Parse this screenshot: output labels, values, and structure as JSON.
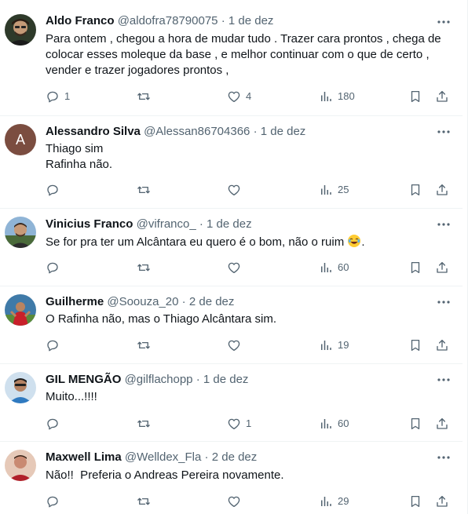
{
  "colors": {
    "text": "#0f1419",
    "secondary": "#536471",
    "border": "#eff3f4"
  },
  "icons": {
    "reply": "reply-icon",
    "retweet": "retweet-icon",
    "like": "like-icon",
    "views": "views-icon",
    "bookmark": "bookmark-icon",
    "share": "share-icon",
    "more": "more-icon"
  },
  "tweets": [
    {
      "name": "Aldo Franco",
      "handle": "@aldofra78790075",
      "dot": "·",
      "date": "1 de dez",
      "lines": [
        "Para ontem , chegou a hora de mudar tudo . Trazer cara prontos , chega de",
        "colocar esses moleque da base , e melhor continuar com o que de certo ,",
        "vender e trazer jogadores prontos ,"
      ],
      "replies": "1",
      "retweets": "",
      "likes": "4",
      "views": "180"
    },
    {
      "name": "Alessandro Silva",
      "handle": "@Alessan86704366",
      "dot": "·",
      "date": "1 de dez",
      "avatar_letter": "A",
      "lines": [
        "Thiago sim",
        "Rafinha não."
      ],
      "replies": "",
      "retweets": "",
      "likes": "",
      "views": "25"
    },
    {
      "name": "Vinicius Franco",
      "handle": "@vifranco_",
      "dot": "·",
      "date": "1 de dez",
      "lines": [
        "Se for pra ter um Alcântara eu quero é o bom, não o ruim"
      ],
      "emoji": "😂",
      "line_end": ".",
      "replies": "",
      "retweets": "",
      "likes": "",
      "views": "60"
    },
    {
      "name": "Guilherme",
      "handle": "@Soouza_20",
      "dot": "·",
      "date": "2 de dez",
      "lines": [
        "O Rafinha não, mas o Thiago Alcântara sim."
      ],
      "replies": "",
      "retweets": "",
      "likes": "",
      "views": "19"
    },
    {
      "name": "GIL MENGÃO",
      "handle": "@gilflachopp",
      "dot": "·",
      "date": "1 de dez",
      "lines": [
        "Muito...!!!!"
      ],
      "replies": "",
      "retweets": "",
      "likes": "1",
      "views": "60"
    },
    {
      "name": "Maxwell Lima",
      "handle": "@Welldex_Fla",
      "dot": "·",
      "date": "2 de dez",
      "lines": [
        "Não!!  Preferia o Andreas Pereira novamente."
      ],
      "replies": "",
      "retweets": "",
      "likes": "",
      "views": "29"
    }
  ]
}
